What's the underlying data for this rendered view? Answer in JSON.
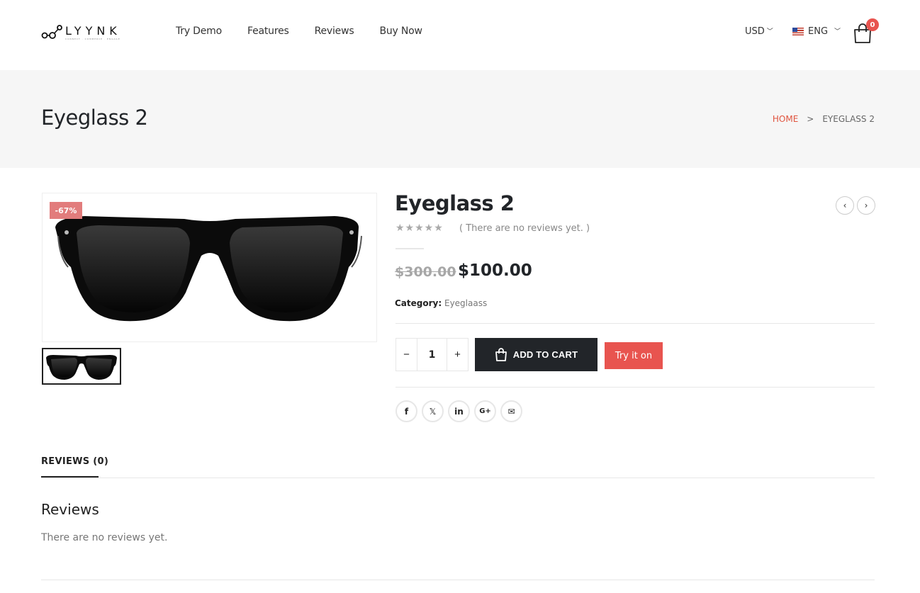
{
  "header": {
    "logo_text": "LYYNK",
    "logo_tagline": "CONNECT · COMMERCE · ENGAGE",
    "nav": [
      "Try Demo",
      "Features",
      "Reviews",
      "Buy Now"
    ],
    "currency": "USD",
    "language": "ENG",
    "cart_count": "0"
  },
  "banner": {
    "title": "Eyeglass 2",
    "breadcrumb_home": "HOME",
    "breadcrumb_sep": ">",
    "breadcrumb_current": "EYEGLASS 2"
  },
  "product": {
    "sale_badge": "-67%",
    "title": "Eyeglass 2",
    "stars": "★★★★★",
    "reviews_text": "( There are no reviews yet. )",
    "old_price": "$300.00",
    "new_price": "$100.00",
    "category_label": "Category:",
    "category_value": "Eyeglaass",
    "qty_minus": "−",
    "qty_value": "1",
    "qty_plus": "+",
    "add_to_cart": "ADD TO CART",
    "try_on": "Try it on"
  },
  "share": {
    "icons": [
      "facebook-icon",
      "x-icon",
      "linkedin-icon",
      "google-plus-icon",
      "email-icon"
    ],
    "labels": [
      "f",
      "𝕏",
      "in",
      "G+",
      "✉"
    ]
  },
  "tabs": {
    "reviews_tab": "REVIEWS (0)",
    "reviews_heading": "Reviews",
    "no_reviews": "There are no reviews yet."
  },
  "colors": {
    "accent": "#e8544f",
    "dark": "#222529",
    "badge": "#e27c7c",
    "banner_bg": "#f6f6f6"
  }
}
